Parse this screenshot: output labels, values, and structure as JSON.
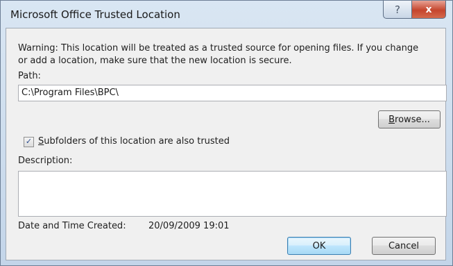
{
  "window": {
    "title": "Microsoft Office Trusted Location",
    "help_label": "?",
    "close_label": "x"
  },
  "warning": "Warning: This location will be treated as a trusted source for opening files. If you change or add a location, make sure that the new location is secure.",
  "path": {
    "label": "Path:",
    "value": "C:\\Program Files\\BPC\\"
  },
  "browse": {
    "label_u": "B",
    "label_rest": "rowse..."
  },
  "subfolders": {
    "checked": true,
    "check_glyph": "✓",
    "label_u": "S",
    "label_rest": "ubfolders of this location are also trusted"
  },
  "description": {
    "label": "Description:",
    "value": ""
  },
  "created": {
    "label": "Date and Time Created:",
    "value": "20/09/2009 19:01"
  },
  "buttons": {
    "ok": "OK",
    "cancel": "Cancel"
  }
}
